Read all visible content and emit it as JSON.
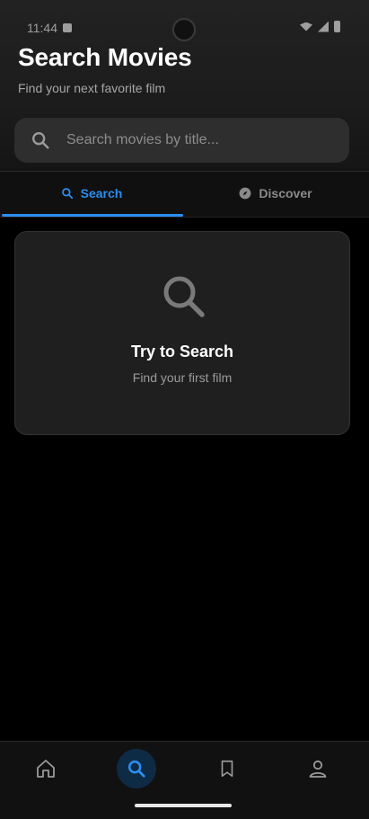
{
  "status_bar": {
    "time": "11:44"
  },
  "header": {
    "title": "Search Movies",
    "subtitle": "Find your next favorite film"
  },
  "search": {
    "placeholder": "Search movies by title...",
    "value": ""
  },
  "tabs": [
    {
      "label": "Search",
      "icon": "search-icon",
      "active": true
    },
    {
      "label": "Discover",
      "icon": "compass-icon",
      "active": false
    }
  ],
  "empty_state": {
    "icon": "search-icon",
    "title": "Try to Search",
    "subtitle": "Find your first film"
  },
  "bottom_nav": {
    "items": [
      {
        "icon": "home-icon",
        "active": false
      },
      {
        "icon": "search-icon",
        "active": true
      },
      {
        "icon": "bookmark-icon",
        "active": false
      },
      {
        "icon": "profile-icon",
        "active": false
      }
    ]
  },
  "colors": {
    "accent": "#2b8ef0",
    "background": "#000000",
    "card": "#1f1f1f",
    "inactive": "#8a8a8a"
  }
}
